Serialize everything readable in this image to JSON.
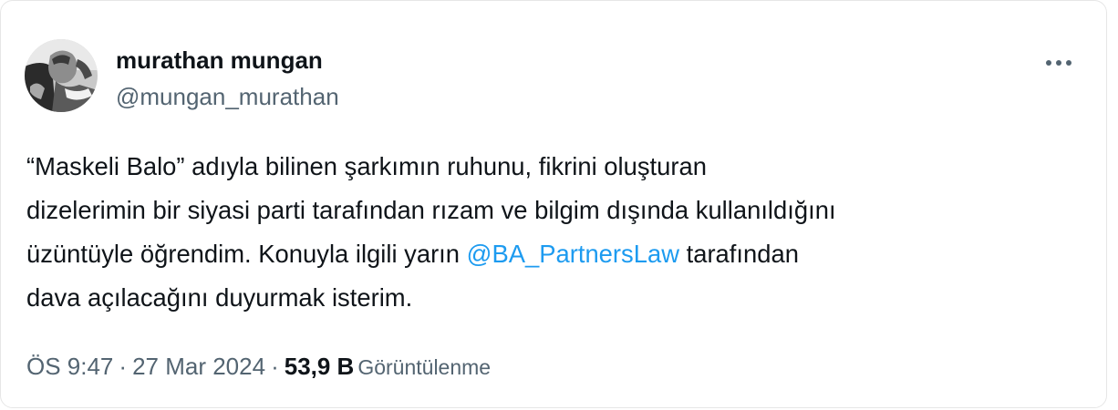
{
  "author": {
    "name": "murathan mungan",
    "handle": "@mungan_murathan"
  },
  "menu": {
    "icon": "more-horizontal-icon"
  },
  "tweet": {
    "lines": [
      {
        "before": "“Maskeli Balo” adıyla bilinen şarkımın ruhunu, fikrini oluşturan"
      },
      {
        "before": "dizelerimin bir siyasi parti tarafından rızam ve bilgim dışında kullanıldığını"
      },
      {
        "before": "üzüntüyle öğrendim. Konuyla ilgili yarın ",
        "mention": "@BA_PartnersLaw",
        "after": " tarafından"
      },
      {
        "before": "dava açılacağını duyurmak isterim."
      }
    ]
  },
  "meta": {
    "time": "ÖS 9:47",
    "separator": "·",
    "date": "27 Mar 2024",
    "views_count": "53,9 B",
    "views_label": "Görüntülenme"
  },
  "colors": {
    "text": "#0f1419",
    "secondary": "#536471",
    "link": "#1d9bf0",
    "border": "#e6e6e6"
  }
}
